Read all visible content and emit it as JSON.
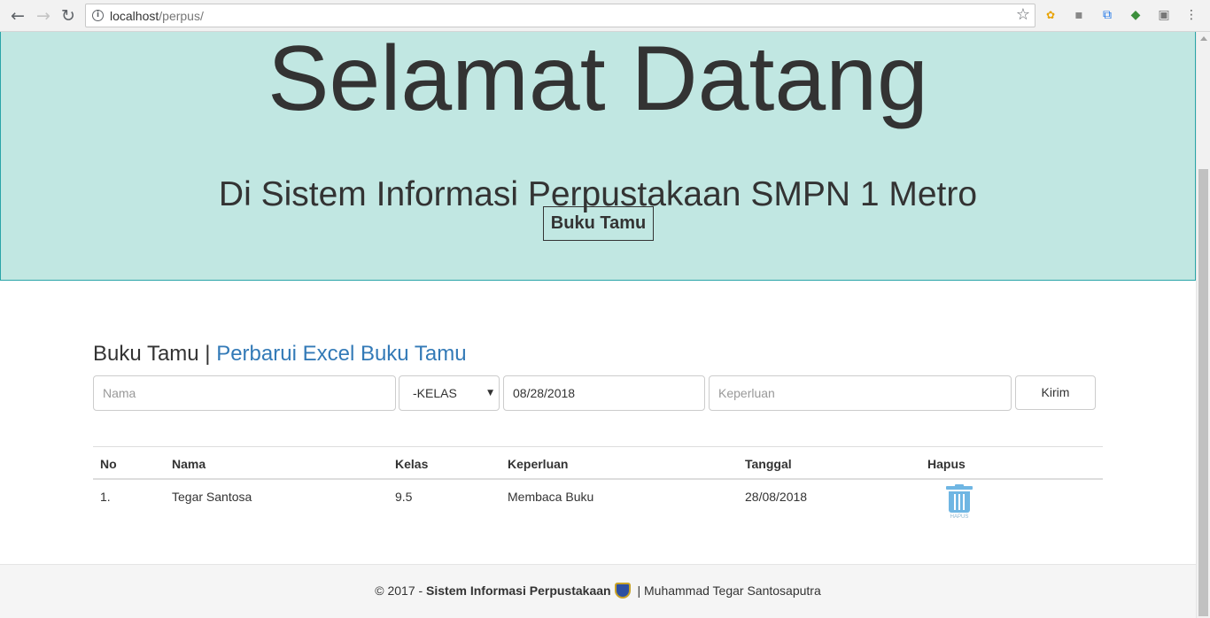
{
  "browser": {
    "url_host": "localhost",
    "url_path": "/perpus/"
  },
  "hero": {
    "title": "Selamat Datang",
    "subtitle": "Di Sistem Informasi Perpustakaan SMPN 1 Metro",
    "button_label": "Buku Tamu"
  },
  "section": {
    "title": "Buku Tamu",
    "separator": " | ",
    "link_label": "Perbarui Excel Buku Tamu"
  },
  "form": {
    "nama_placeholder": "Nama",
    "kelas_selected": "-KELAS",
    "tanggal_value": "08/28/2018",
    "keperluan_placeholder": "Keperluan",
    "submit_label": "Kirim"
  },
  "table": {
    "headers": [
      "No",
      "Nama",
      "Kelas",
      "Keperluan",
      "Tanggal",
      "Hapus"
    ],
    "rows": [
      {
        "no": "1.",
        "nama": "Tegar Santosa",
        "kelas": "9.5",
        "keperluan": "Membaca Buku",
        "tanggal": "28/08/2018",
        "hapus_label": "HAPUS"
      }
    ]
  },
  "footer": {
    "prefix": "© 2017 - ",
    "app_name": "Sistem Informasi Perpustakaan",
    "author": " | Muhammad Tegar Santosaputra"
  },
  "colors": {
    "jumbotron_bg": "#c1e7e2",
    "link": "#337ab7",
    "trash_icon": "#6fb6e3"
  }
}
